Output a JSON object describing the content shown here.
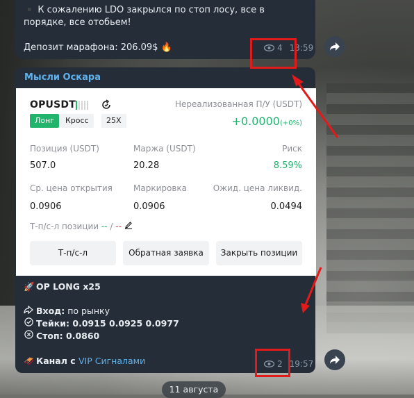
{
  "message1": {
    "line1": "▪️ К сожалению LDO закрылся по стоп лосу, все в порядке, все отобьем!",
    "line2": "Депозит марафона: 206.09$ 🔥",
    "views": "4",
    "time": "13:59"
  },
  "message2": {
    "author": "Мысли Оскара",
    "card": {
      "symbol": "OPUSDT",
      "side_tag": "Лонг",
      "mode_tag": "Кросс",
      "leverage_tag": "25X",
      "unrealized_label": "Нереализованная П/У (USDT)",
      "unrealized_value": "+0.0000",
      "unrealized_pct": "(+0%)",
      "position_label": "Позиция (USDT)",
      "position_value": "507.0",
      "margin_label": "Маржа (USDT)",
      "margin_value": "20.28",
      "risk_label": "Риск",
      "risk_value": "8.59%",
      "entry_label": "Ср. цена открытия",
      "entry_value": "0.0906",
      "mark_label": "Маркировка",
      "mark_value": "0.0906",
      "liq_label": "Ожид. цена ликвид.",
      "liq_value": "0.0494",
      "tpsl_label": "Т-п/с-л позиции",
      "tpsl_tp": "--",
      "tpsl_sep": " / ",
      "tpsl_sl": "--",
      "btn_tpsl": "Т-п/с-л",
      "btn_reverse": "Обратная заявка",
      "btn_close": "Закрыть позиции"
    },
    "title": "OP LONG x25",
    "entry_prefix": "Вход:",
    "entry_text": " по рынку",
    "targets_prefix": "Тейки:",
    "targets_text": " 0.0915 0.0925 0.0977",
    "stop_prefix": "Стоп:",
    "stop_text": " 0.0860",
    "channel_prefix": "Канал с ",
    "channel_link": "VIP Сигналами",
    "views": "2",
    "time": "19:57"
  },
  "date_pill": "11 августа",
  "colors": {
    "accent_green": "#21b46d",
    "link_blue": "#5fb2ed",
    "annotation_red": "#e11a1a"
  }
}
